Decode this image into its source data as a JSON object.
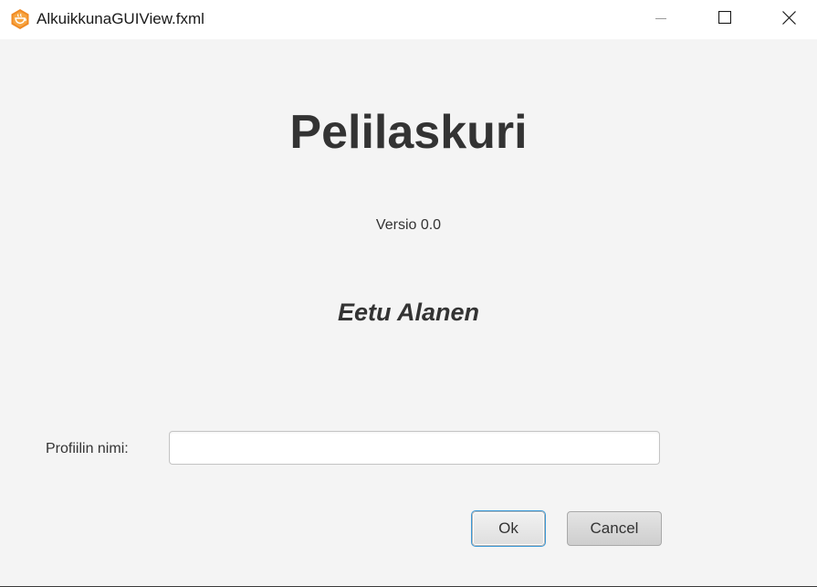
{
  "window": {
    "title": "AlkuikkunaGUIView.fxml",
    "app_icon": "java-cup-icon",
    "controls": {
      "minimize_icon": "minimize-icon",
      "maximize_icon": "maximize-icon",
      "close_icon": "close-icon"
    }
  },
  "main": {
    "heading": "Pelilaskuri",
    "version": "Versio 0.0",
    "author": "Eetu Alanen"
  },
  "form": {
    "profile_label": "Profiilin nimi:",
    "profile_value": "",
    "profile_placeholder": ""
  },
  "buttons": {
    "ok_label": "Ok",
    "cancel_label": "Cancel"
  },
  "colors": {
    "background": "#f4f4f4",
    "text": "#333333",
    "focus_ring": "#3a9ad9",
    "icon_orange": "#f08a24"
  }
}
